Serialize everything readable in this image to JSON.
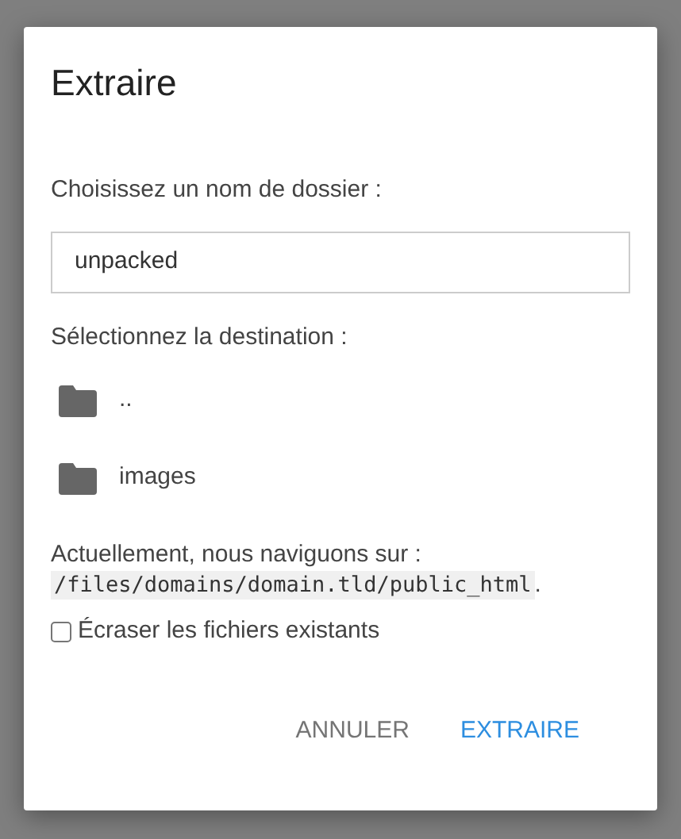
{
  "dialog": {
    "title": "Extraire",
    "name_label": "Choisissez un nom de dossier :",
    "name_field": {
      "value": "unpacked"
    },
    "destination_label": "Sélectionnez la destination :",
    "folders": [
      {
        "name": "..",
        "selected": false
      },
      {
        "name": "images",
        "selected": false
      }
    ],
    "location": {
      "text": "Actuellement, nous naviguons sur :",
      "path": "/files/domains/domain.tld/public_html",
      "suffix": "."
    },
    "overwrite": {
      "label": "Écraser les fichiers existants",
      "checked": false
    },
    "buttons": [
      {
        "label": "ANNULER",
        "kind": "cancel"
      },
      {
        "label": "EXTRAIRE",
        "kind": "confirm"
      }
    ]
  }
}
